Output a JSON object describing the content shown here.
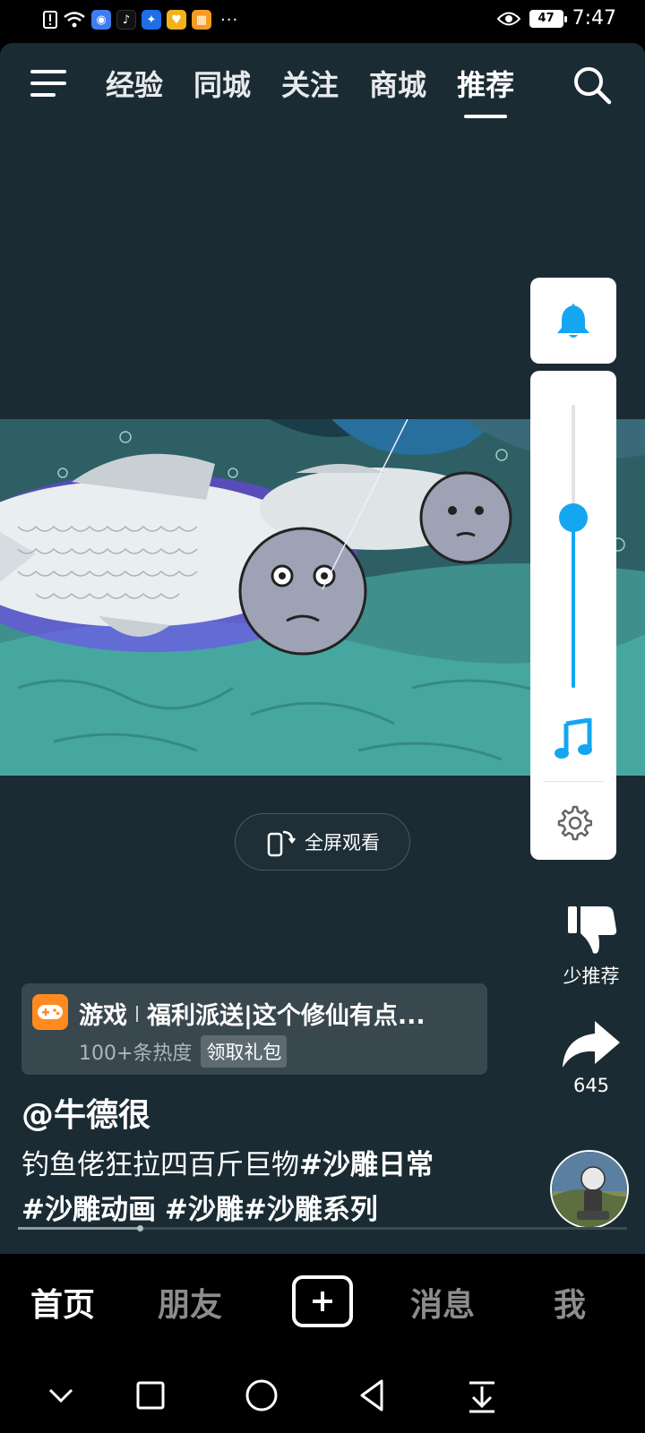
{
  "status_bar": {
    "time": "7:47",
    "battery": "47",
    "more": "···",
    "icons": [
      "alert-icon",
      "wifi-icon",
      "browser-icon",
      "tiktok-icon",
      "bulb-icon",
      "heart-app-icon",
      "orange-app-icon",
      "eye-icon"
    ]
  },
  "topnav": {
    "tabs": [
      {
        "label": "经验"
      },
      {
        "label": "同城"
      },
      {
        "label": "关注"
      },
      {
        "label": "商城"
      },
      {
        "label": "推荐"
      }
    ],
    "active_tab": "推荐"
  },
  "video": {
    "fullscreen_label": "全屏观看"
  },
  "side_actions": {
    "dislike_label": "少推荐",
    "share_count": "645"
  },
  "volume_overlay": {
    "level": 0.6,
    "accent": "#15a6f2"
  },
  "ad": {
    "category": "游戏",
    "title": "福利派送|这个修仙有点...",
    "heat": "100+条热度",
    "button": "领取礼包"
  },
  "post": {
    "author": "@牛德很",
    "caption_text": "钓鱼佬狂拉四百斤巨物",
    "tags": [
      "#沙雕日常",
      "#沙雕动画",
      "#沙雕",
      "#沙雕系列"
    ],
    "progress": 0.2
  },
  "bottom_nav": {
    "home": "首页",
    "friends": "朋友",
    "messages": "消息",
    "me": "我"
  },
  "colors": {
    "app_bg": "#1b2b33",
    "accent": "#15a6f2"
  }
}
